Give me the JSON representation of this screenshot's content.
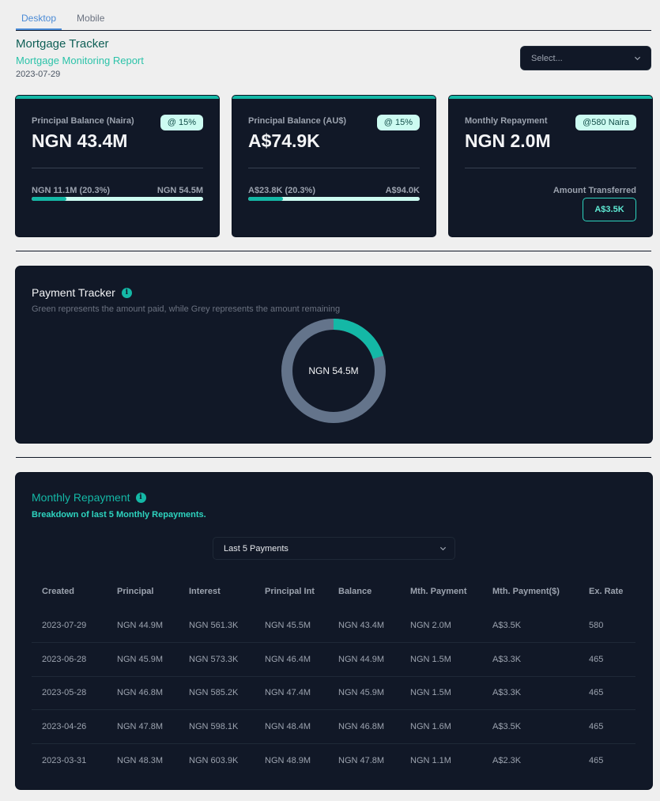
{
  "tabs": [
    {
      "label": "Desktop"
    },
    {
      "label": "Mobile"
    }
  ],
  "header": {
    "title": "Mortgage Tracker",
    "subtitle": "Mortgage Monitoring Report",
    "date": "2023-07-29",
    "select_placeholder": "Select..."
  },
  "cards": [
    {
      "label": "Principal Balance (Naira)",
      "value": "NGN 43.4M",
      "badge": "@ 15%",
      "progress_left": "NGN 11.1M (20.3%)",
      "progress_right": "NGN 54.5M",
      "progress_fraction": 0.203
    },
    {
      "label": "Principal Balance (AU$)",
      "value": "A$74.9K",
      "badge": "@ 15%",
      "progress_left": "A$23.8K (20.3%)",
      "progress_right": "A$94.0K",
      "progress_fraction": 0.203
    },
    {
      "label": "Monthly Repayment",
      "value": "NGN 2.0M",
      "badge": "@580 Naira",
      "transferred_label": "Amount Transferred",
      "transferred_value": "A$3.5K"
    }
  ],
  "payment_tracker": {
    "title": "Payment Tracker",
    "description": "Green represents the amount paid, while Grey represents the amount remaining",
    "center_label": "NGN 54.5M",
    "paid_fraction": 0.203,
    "paid_color": "#14b8a6",
    "remaining_color": "#64748b"
  },
  "monthly_repayment": {
    "title": "Monthly Repayment",
    "subtitle": "Breakdown of last 5 Monthly Repayments.",
    "filter_value": "Last 5 Payments",
    "columns": [
      "Created",
      "Principal",
      "Interest",
      "Principal Int",
      "Balance",
      "Mth. Payment",
      "Mth. Payment($)",
      "Ex. Rate"
    ],
    "rows": [
      [
        "2023-07-29",
        "NGN 44.9M",
        "NGN 561.3K",
        "NGN 45.5M",
        "NGN 43.4M",
        "NGN 2.0M",
        "A$3.5K",
        "580"
      ],
      [
        "2023-06-28",
        "NGN 45.9M",
        "NGN 573.3K",
        "NGN 46.4M",
        "NGN 44.9M",
        "NGN 1.5M",
        "A$3.3K",
        "465"
      ],
      [
        "2023-05-28",
        "NGN 46.8M",
        "NGN 585.2K",
        "NGN 47.4M",
        "NGN 45.9M",
        "NGN 1.5M",
        "A$3.3K",
        "465"
      ],
      [
        "2023-04-26",
        "NGN 47.8M",
        "NGN 598.1K",
        "NGN 48.4M",
        "NGN 46.8M",
        "NGN 1.6M",
        "A$3.5K",
        "465"
      ],
      [
        "2023-03-31",
        "NGN 48.3M",
        "NGN 603.9K",
        "NGN 48.9M",
        "NGN 47.8M",
        "NGN 1.1M",
        "A$2.3K",
        "465"
      ]
    ]
  },
  "colors": {
    "accent": "#14b8a6",
    "panel": "#111827",
    "background": "#efefef"
  }
}
